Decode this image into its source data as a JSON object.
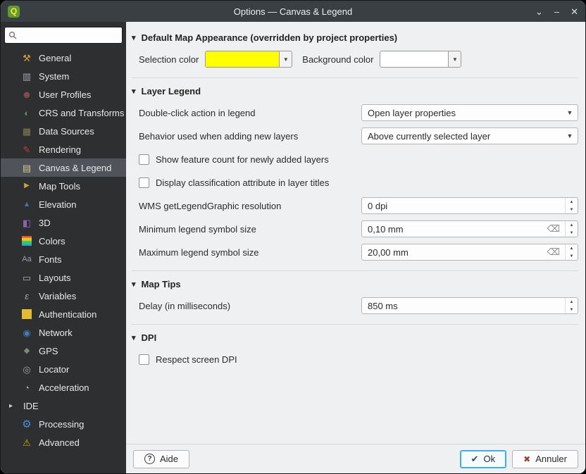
{
  "window": {
    "title": "Options — Canvas & Legend"
  },
  "titlebar": {
    "shade": "⌄",
    "minimize": "–",
    "close": "✕"
  },
  "colors": {
    "selection": "#ffff00",
    "background": "#ffffff",
    "focus": "#3daee9"
  },
  "sidebar": {
    "search": {
      "placeholder": "",
      "value": ""
    },
    "items": [
      {
        "label": "General",
        "icon": "wrench-icon"
      },
      {
        "label": "System",
        "icon": "system-icon"
      },
      {
        "label": "User Profiles",
        "icon": "user-icon"
      },
      {
        "label": "CRS and Transforms",
        "icon": "globe-crs-icon"
      },
      {
        "label": "Data Sources",
        "icon": "database-icon"
      },
      {
        "label": "Rendering",
        "icon": "paintbrush-icon"
      },
      {
        "label": "Canvas & Legend",
        "icon": "map-legend-icon",
        "selected": true
      },
      {
        "label": "Map Tools",
        "icon": "map-tools-icon"
      },
      {
        "label": "Elevation",
        "icon": "elevation-icon"
      },
      {
        "label": "3D",
        "icon": "cube-3d-icon"
      },
      {
        "label": "Colors",
        "icon": "color-bars-icon"
      },
      {
        "label": "Fonts",
        "icon": "fonts-icon"
      },
      {
        "label": "Layouts",
        "icon": "layout-icon"
      },
      {
        "label": "Variables",
        "icon": "epsilon-icon"
      },
      {
        "label": "Authentication",
        "icon": "lock-icon"
      },
      {
        "label": "Network",
        "icon": "network-icon"
      },
      {
        "label": "GPS",
        "icon": "gps-icon"
      },
      {
        "label": "Locator",
        "icon": "magnifier-icon"
      },
      {
        "label": "Acceleration",
        "icon": "gauge-icon"
      },
      {
        "label": "IDE",
        "icon": "expand-arrow",
        "expandable": true
      },
      {
        "label": "Processing",
        "icon": "gear-icon"
      },
      {
        "label": "Advanced",
        "icon": "warning-icon"
      }
    ]
  },
  "sections": {
    "appearance": {
      "title": "Default Map Appearance (overridden by project properties)",
      "selection_color_label": "Selection color",
      "selection_color": "#ffff00",
      "background_color_label": "Background color",
      "background_color": "#ffffff"
    },
    "layer_legend": {
      "title": "Layer Legend",
      "double_click_label": "Double-click action in legend",
      "double_click_value": "Open layer properties",
      "behavior_label": "Behavior used when adding new layers",
      "behavior_value": "Above currently selected layer",
      "feature_count_label": "Show feature count for newly added layers",
      "feature_count_checked": false,
      "classification_label": "Display classification attribute in layer titles",
      "classification_checked": false,
      "wms_label": "WMS getLegendGraphic resolution",
      "wms_value": "0 dpi",
      "min_symbol_label": "Minimum legend symbol size",
      "min_symbol_value": "0,10 mm",
      "max_symbol_label": "Maximum legend symbol size",
      "max_symbol_value": "20,00 mm"
    },
    "map_tips": {
      "title": "Map Tips",
      "delay_label": "Delay (in milliseconds)",
      "delay_value": "850 ms"
    },
    "dpi": {
      "title": "DPI",
      "respect_label": "Respect screen DPI",
      "respect_checked": false
    }
  },
  "footer": {
    "help": "Aide",
    "ok": "Ok",
    "cancel": "Annuler"
  }
}
